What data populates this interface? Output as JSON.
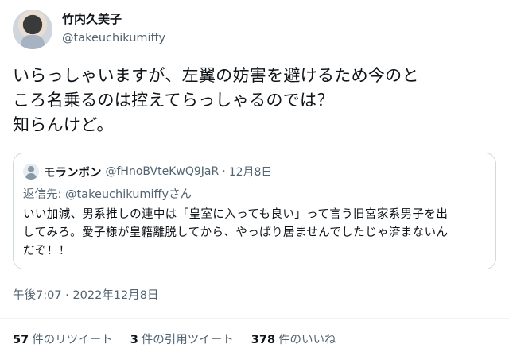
{
  "author": {
    "display_name": "竹内久美子",
    "handle": "@takeuchikumiffy"
  },
  "tweet": {
    "text_line1": "いらっしゃいますが、左翼の妨害を避けるため今のと",
    "text_line2": "ころ名乗るのは控えてらっしゃるのでは？",
    "text_line3": "知らんけど。"
  },
  "quoted": {
    "display_name": "モランボン",
    "handle": "@fHnoBVteKwQ9JaR",
    "separator": "·",
    "date": "12月8日",
    "reply_prefix": "返信先: ",
    "reply_to": "@takeuchikumiffyさん",
    "text_line1": "いい加減、男系推しの連中は「皇室に入っても良い」って言う旧宮家系男子を出",
    "text_line2": "してみろ。愛子様が皇籍離脱してから、やっぱり居ませんでしたじゃ済まないん",
    "text_line3": "だぞ！！"
  },
  "timestamp": "午後7:07 · 2022年12月8日",
  "stats": [
    {
      "count": "57",
      "label": "件のリツイート"
    },
    {
      "count": "3",
      "label": "件の引用ツイート"
    },
    {
      "count": "378",
      "label": "件のいいね"
    }
  ],
  "icons": {
    "avatar": "user-avatar",
    "quoted_avatar": "default-avatar-icon",
    "more": "more-options-icon"
  },
  "colors": {
    "text": "#0f1419",
    "secondary": "#536471",
    "border": "#cfd9de"
  }
}
